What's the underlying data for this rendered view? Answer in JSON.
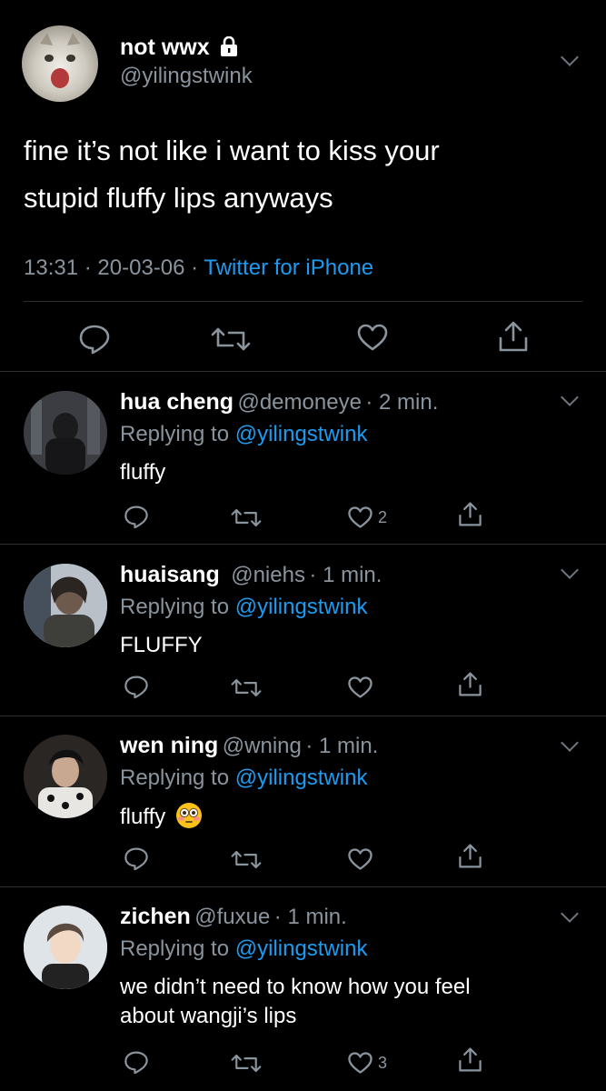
{
  "main": {
    "author_name": "not wwx",
    "author_handle": "@yilingstwink",
    "text_line1": "fine it’s not like i want to kiss your",
    "text_line2": "stupid fluffy lips anyways",
    "time": "13:31",
    "date": "20-03-06",
    "sep": "·",
    "source": "Twitter for iPhone",
    "icons": [
      "reply-icon",
      "retweet-icon",
      "like-icon",
      "share-icon",
      "lock-icon",
      "chevron-down-icon"
    ]
  },
  "replying_to_label": "Replying to",
  "replies": [
    {
      "name": "hua cheng",
      "handle": "@demoneye",
      "time": "· 2 min.",
      "replying_to": "@yilingstwink",
      "text": "fluffy",
      "text2": "",
      "likes": "2"
    },
    {
      "name": "huaisang",
      "handle": "@niehs",
      "time": "· 1 min.",
      "replying_to": "@yilingstwink",
      "text": "FLUFFY",
      "text2": "",
      "likes": ""
    },
    {
      "name": "wen ning",
      "handle": "@wning",
      "time": "· 1 min.",
      "replying_to": "@yilingstwink",
      "text": "fluffy",
      "text2": "",
      "emoji": "flushed-face-emoji",
      "likes": ""
    },
    {
      "name": "zichen",
      "handle": "@fuxue",
      "time": "· 1 min.",
      "replying_to": "@yilingstwink",
      "text": "we didn’t need to know how you feel",
      "text2": "about wangji’s lips",
      "likes": "3"
    }
  ],
  "colors": {
    "accent": "#1d9bf0",
    "muted": "#8a949d",
    "background": "#000000"
  }
}
